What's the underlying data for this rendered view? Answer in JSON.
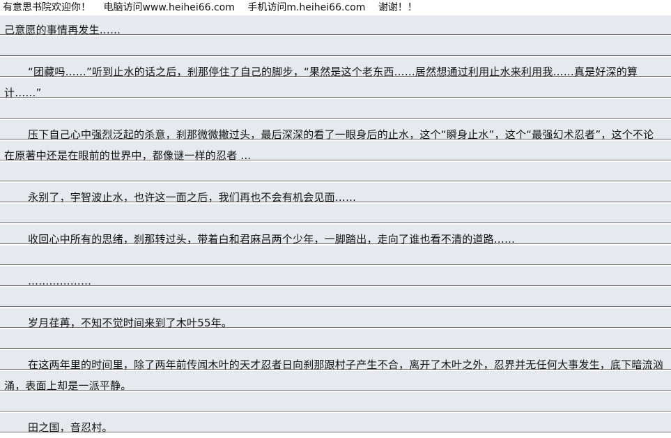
{
  "banner": {
    "welcome": "有意思书院欢迎你！",
    "pc": "电脑访问www.heihei66.com",
    "mobile": "手机访问m.heihei66.com",
    "thanks": "谢谢！！"
  },
  "paragraphs": [
    "己意愿的事情再发生……",
    "“团藏吗……”听到止水的话之后，刹那停住了自己的脚步，“果然是这个老东西……居然想通过利用止水来利用我……真是好深的算计……”",
    "压下自己心中强烈泛起的杀意，刹那微微撇过头，最后深深的看了一眼身后的止水，这个“瞬身止水”，这个“最强幻术忍者”，这个不论在原著中还是在眼前的世界中，都像谜一样的忍者 ...",
    "永别了，宇智波止水，也许这一面之后，我们再也不会有机会见面……",
    "收回心中所有的思绪，刹那转过头，带着白和君麻吕两个少年，一脚踏出，走向了谁也看不清的道路……",
    "………………",
    "岁月荏苒，不知不觉时间来到了木叶55年。",
    "在这两年里的时间里，除了两年前传闻木叶的天才忍者日向刹那跟村子产生不合，离开了木叶之外，忍界并无任何大事发生，底下暗流汹涌，表面上却是一派平静。",
    "田之国，音忍村。"
  ]
}
